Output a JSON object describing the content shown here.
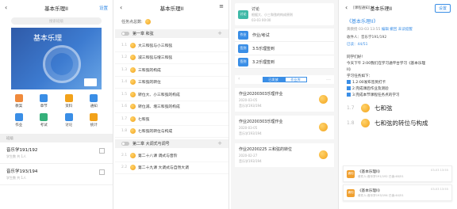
{
  "p1": {
    "title": "基本乐理II",
    "settings": "设置",
    "search_placeholder": "搜索班级",
    "cover_title": "基本乐理",
    "grid": [
      {
        "label": "教案",
        "icon": "lesson-plan-icon",
        "color": "#f08a3c"
      },
      {
        "label": "章节",
        "icon": "chapter-icon",
        "color": "#3a8ee6"
      },
      {
        "label": "资料",
        "icon": "folder-icon",
        "color": "#f2a21a"
      },
      {
        "label": "通知",
        "icon": "notice-icon",
        "color": "#3a8ee6"
      },
      {
        "label": "作业",
        "icon": "homework-icon",
        "color": "#3a8ee6"
      },
      {
        "label": "考试",
        "icon": "exam-icon",
        "color": "#35b07a"
      },
      {
        "label": "讨论",
        "icon": "discussion-icon",
        "color": "#3a8ee6"
      },
      {
        "label": "统计",
        "icon": "statistics-icon",
        "color": "#f2a21a"
      }
    ],
    "section_header": "班级",
    "classes": [
      {
        "name": "音乐学191/192",
        "sub": "学生数 共 1人"
      },
      {
        "name": "音乐学193/194",
        "sub": "学生数 共 1人"
      }
    ]
  },
  "p2": {
    "title": "基本乐理II",
    "task_total": "任务点总数:",
    "chapters": [
      {
        "title": "第一章  和弦",
        "sections": [
          {
            "n": "1.1",
            "t": "大三和弦与小三和弦"
          },
          {
            "n": "1.2",
            "t": "减三和弦与增三和弦"
          },
          {
            "n": "1.3",
            "t": "三和弦的构成"
          },
          {
            "n": "1.4",
            "t": "三和弦的转位"
          },
          {
            "n": "1.5",
            "t": "转位大、小三和弦的构成"
          },
          {
            "n": "1.6",
            "t": "转位减、增三和弦的构成"
          },
          {
            "n": "1.7",
            "t": "七和弦"
          },
          {
            "n": "1.8",
            "t": "七和弦的转位与构成"
          }
        ]
      },
      {
        "title": "第二章  大调式与调号",
        "sections": [
          {
            "n": "2.1",
            "t": "第二十八课  调式与音阶"
          },
          {
            "n": "2.2",
            "t": "第二十九课  大调式与自然大调"
          }
        ]
      }
    ]
  },
  "p3": {
    "discussion": {
      "title": "讨论",
      "sub": "根据大、小三和弦的构成原则",
      "date": "03-03 00:00"
    },
    "rows": [
      {
        "icon": "作业",
        "label": "作业/考试"
      },
      {
        "icon": "签到",
        "label": "3.5乐理签到"
      },
      {
        "icon": "签到",
        "label": "3.2乐理签到"
      }
    ],
    "tabs": [
      "已发放",
      "作业库"
    ],
    "homeworks": [
      {
        "title": "作业20200303乐理作业",
        "date": "2020-03-05",
        "cls": "音乐学193/194"
      },
      {
        "title": "作业20200303乐理作业",
        "date": "2020-03-05",
        "cls": "音乐学193/194"
      },
      {
        "title": "作业20200225 三和弦的转位",
        "date": "2020-02-27",
        "cls": "音乐学193/194"
      }
    ]
  },
  "p4": {
    "tag": "[课程通知]",
    "tag_title": "基本乐理II",
    "settings": "设置",
    "course": "《基本乐理II》",
    "meta": [
      "黄教授",
      "03-03 13:55",
      "编辑",
      "撤回",
      "未读提醒"
    ],
    "recipients": "收件人：音乐学191/192",
    "read": "已读：44/51",
    "body": [
      "同学们好!",
      "今天下午 2:00我们在学习通平台学习《基本乐理",
      "II》",
      "学习任务如下：",
      "1.2:00发布签到打卡",
      "2.完成课后作业及测验",
      "3.完成本节课程任务点的学习"
    ],
    "big": [
      {
        "n": "1.7",
        "t": "七和弦"
      },
      {
        "n": "1.8",
        "t": "七和弦的转位与构成"
      }
    ],
    "messages": [
      {
        "title": "《基本乐理II》",
        "sub": "收件人:音乐学191/192  已读:48/51",
        "date": "03-03 13:55"
      },
      {
        "title": "《基本乐理II》",
        "sub": "收件人:音乐学193/194  已读:44/51",
        "date": "03-03 13:55"
      }
    ]
  }
}
